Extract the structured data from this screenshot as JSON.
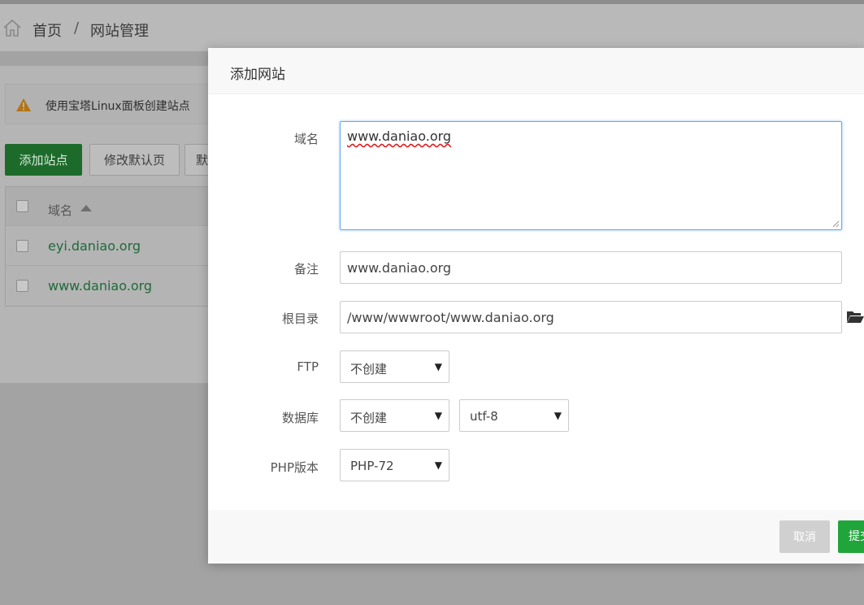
{
  "breadcrumb": {
    "home": "首页",
    "separator": "/",
    "current": "网站管理"
  },
  "alert": {
    "text": "使用宝塔Linux面板创建站点"
  },
  "toolbar": {
    "add_site": "添加站点",
    "edit_default_page": "修改默认页",
    "default_site_partial": "默"
  },
  "table": {
    "header_domain": "域名",
    "rows": [
      {
        "domain": "eyi.daniao.org"
      },
      {
        "domain": "www.daniao.org"
      }
    ]
  },
  "modal": {
    "title": "添加网站",
    "domain_label": "域名",
    "domain_value": "www.daniao.org",
    "note_label": "备注",
    "note_value": "www.daniao.org",
    "root_label": "根目录",
    "root_value": "/www/wwwroot/www.daniao.org",
    "ftp_label": "FTP",
    "ftp_value": "不创建",
    "db_label": "数据库",
    "db_value": "不创建",
    "db_charset": "utf-8",
    "php_label": "PHP版本",
    "php_value": "PHP-72",
    "cancel": "取消",
    "submit": "提交"
  },
  "colors": {
    "primary_green": "#20a53a",
    "focus_blue": "#66aaee",
    "link_green": "#1f6a3a"
  },
  "icons": [
    "home-icon",
    "warning-icon",
    "sort-up-icon",
    "folder-open-icon",
    "dropdown-caret-icon",
    "resize-grip-icon"
  ]
}
